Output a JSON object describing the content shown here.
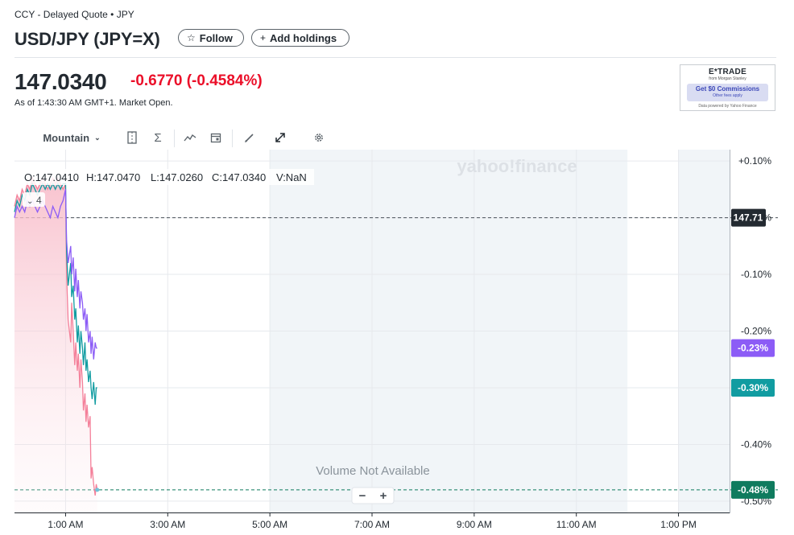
{
  "header": {
    "subtitle": "CCY - Delayed Quote • JPY",
    "title": "USD/JPY (JPY=X)",
    "follow_label": "Follow",
    "add_holdings_label": "Add holdings"
  },
  "quote": {
    "price": "147.0340",
    "change": "-0.6770 (-0.4584%)",
    "as_of": "As of 1:43:30 AM GMT+1. Market Open."
  },
  "ad": {
    "brand": "E*TRADE",
    "brand_sub": "from Morgan Stanley",
    "cta": "Get $0 Commissions",
    "cta_sub": "Other fees apply",
    "footer": "Data powered by Yahoo Finance"
  },
  "toolbar": {
    "chart_type": "Mountain",
    "icons": [
      "compare-icon",
      "indicators-icon",
      "trend-icon",
      "calendar-icon",
      "draw-icon",
      "expand-icon",
      "settings-icon"
    ]
  },
  "chart": {
    "watermark": "yahoo!finance",
    "ohlc": {
      "o": "O:147.0410",
      "h": "H:147.0470",
      "l": "L:147.0260",
      "c": "C:147.0340",
      "v": "V:NaN"
    },
    "collapse_badge": "4",
    "volume_note": "Volume Not Available",
    "zoom_out": "−",
    "zoom_in": "+",
    "price_tag": "147.71",
    "tags": [
      {
        "label": "-0.23%",
        "color": "#8c5cf6"
      },
      {
        "label": "-0.30%",
        "color": "#119ca1"
      },
      {
        "label": "-0.48%",
        "color": "#0f7b5e"
      }
    ]
  },
  "chart_data": {
    "type": "line",
    "x_tick_labels": [
      "1:00 AM",
      "3:00 AM",
      "5:00 AM",
      "7:00 AM",
      "9:00 AM",
      "11:00 AM",
      "1:00 PM"
    ],
    "x_ticks_hours": [
      1,
      3,
      5,
      7,
      9,
      11,
      13
    ],
    "x_range_hours": [
      0,
      14
    ],
    "y_tick_labels": [
      "+0.10%",
      "0.00%",
      "-0.10%",
      "-0.20%",
      "-0.30%",
      "-0.40%",
      "-0.50%"
    ],
    "y_ticks": [
      0.1,
      0.0,
      -0.1,
      -0.2,
      -0.3,
      -0.4,
      -0.5
    ],
    "y_range": [
      -0.52,
      0.12
    ],
    "shaded_sessions_hours": [
      [
        5,
        12
      ],
      [
        13,
        14
      ]
    ],
    "reference_lines": [
      0.0,
      -0.48
    ],
    "series": [
      {
        "color": "#f4809a",
        "area": true,
        "points": [
          [
            0,
            0.02
          ],
          [
            0.05,
            0.04
          ],
          [
            0.1,
            0.03
          ],
          [
            0.15,
            0.05
          ],
          [
            0.2,
            0.04
          ],
          [
            0.25,
            0.06
          ],
          [
            0.3,
            0.05
          ],
          [
            0.35,
            0.07
          ],
          [
            0.4,
            0.06
          ],
          [
            0.45,
            0.05
          ],
          [
            0.5,
            0.06
          ],
          [
            0.55,
            0.07
          ],
          [
            0.6,
            0.06
          ],
          [
            0.65,
            0.05
          ],
          [
            0.7,
            0.06
          ],
          [
            0.75,
            0.07
          ],
          [
            0.8,
            0.06
          ],
          [
            0.85,
            0.07
          ],
          [
            0.9,
            0.06
          ],
          [
            0.95,
            0.05
          ],
          [
            1.0,
            0.06
          ],
          [
            1.02,
            -0.1
          ],
          [
            1.05,
            -0.18
          ],
          [
            1.1,
            -0.22
          ],
          [
            1.12,
            -0.15
          ],
          [
            1.15,
            -0.2
          ],
          [
            1.18,
            -0.26
          ],
          [
            1.2,
            -0.22
          ],
          [
            1.23,
            -0.27
          ],
          [
            1.25,
            -0.24
          ],
          [
            1.28,
            -0.3
          ],
          [
            1.3,
            -0.25
          ],
          [
            1.33,
            -0.29
          ],
          [
            1.35,
            -0.34
          ],
          [
            1.38,
            -0.31
          ],
          [
            1.4,
            -0.36
          ],
          [
            1.42,
            -0.33
          ],
          [
            1.45,
            -0.37
          ],
          [
            1.48,
            -0.35
          ],
          [
            1.5,
            -0.46
          ],
          [
            1.52,
            -0.44
          ],
          [
            1.55,
            -0.47
          ],
          [
            1.58,
            -0.49
          ],
          [
            1.6,
            -0.47
          ],
          [
            1.62,
            -0.48
          ]
        ]
      },
      {
        "color": "#119ca1",
        "area": false,
        "points": [
          [
            0,
            0.01
          ],
          [
            0.05,
            0.03
          ],
          [
            0.1,
            0.02
          ],
          [
            0.15,
            0.04
          ],
          [
            0.2,
            0.03
          ],
          [
            0.25,
            0.05
          ],
          [
            0.3,
            0.04
          ],
          [
            0.35,
            0.06
          ],
          [
            0.4,
            0.05
          ],
          [
            0.45,
            0.04
          ],
          [
            0.5,
            0.05
          ],
          [
            0.55,
            0.06
          ],
          [
            0.6,
            0.05
          ],
          [
            0.65,
            0.06
          ],
          [
            0.7,
            0.05
          ],
          [
            0.75,
            0.06
          ],
          [
            0.8,
            0.05
          ],
          [
            0.85,
            0.06
          ],
          [
            0.9,
            0.05
          ],
          [
            0.95,
            0.06
          ],
          [
            1.0,
            0.06
          ],
          [
            1.02,
            -0.06
          ],
          [
            1.05,
            -0.12
          ],
          [
            1.1,
            -0.08
          ],
          [
            1.12,
            -0.14
          ],
          [
            1.15,
            -0.12
          ],
          [
            1.18,
            -0.18
          ],
          [
            1.2,
            -0.16
          ],
          [
            1.23,
            -0.22
          ],
          [
            1.25,
            -0.19
          ],
          [
            1.28,
            -0.24
          ],
          [
            1.3,
            -0.2
          ],
          [
            1.33,
            -0.23
          ],
          [
            1.35,
            -0.26
          ],
          [
            1.38,
            -0.22
          ],
          [
            1.4,
            -0.27
          ],
          [
            1.42,
            -0.25
          ],
          [
            1.45,
            -0.29
          ],
          [
            1.48,
            -0.27
          ],
          [
            1.5,
            -0.3
          ],
          [
            1.52,
            -0.32
          ],
          [
            1.55,
            -0.29
          ],
          [
            1.58,
            -0.33
          ],
          [
            1.6,
            -0.3
          ],
          [
            1.62,
            -0.3
          ]
        ]
      },
      {
        "color": "#8c5cf6",
        "area": false,
        "points": [
          [
            0,
            0.0
          ],
          [
            0.05,
            0.02
          ],
          [
            0.1,
            0.01
          ],
          [
            0.15,
            0.02
          ],
          [
            0.2,
            0.01
          ],
          [
            0.25,
            0.03
          ],
          [
            0.3,
            0.02
          ],
          [
            0.35,
            0.03
          ],
          [
            0.4,
            0.02
          ],
          [
            0.45,
            0.01
          ],
          [
            0.5,
            0.02
          ],
          [
            0.55,
            0.03
          ],
          [
            0.6,
            0.02
          ],
          [
            0.65,
            0.01
          ],
          [
            0.7,
            0.0
          ],
          [
            0.75,
            0.02
          ],
          [
            0.8,
            0.01
          ],
          [
            0.85,
            0.0
          ],
          [
            0.9,
            0.02
          ],
          [
            0.95,
            0.03
          ],
          [
            1.0,
            0.05
          ],
          [
            1.02,
            -0.04
          ],
          [
            1.05,
            -0.08
          ],
          [
            1.1,
            -0.05
          ],
          [
            1.12,
            -0.1
          ],
          [
            1.15,
            -0.07
          ],
          [
            1.18,
            -0.13
          ],
          [
            1.2,
            -0.09
          ],
          [
            1.23,
            -0.14
          ],
          [
            1.25,
            -0.11
          ],
          [
            1.28,
            -0.16
          ],
          [
            1.3,
            -0.13
          ],
          [
            1.33,
            -0.15
          ],
          [
            1.35,
            -0.18
          ],
          [
            1.38,
            -0.16
          ],
          [
            1.4,
            -0.2
          ],
          [
            1.42,
            -0.17
          ],
          [
            1.45,
            -0.22
          ],
          [
            1.48,
            -0.2
          ],
          [
            1.5,
            -0.24
          ],
          [
            1.52,
            -0.21
          ],
          [
            1.55,
            -0.25
          ],
          [
            1.58,
            -0.22
          ],
          [
            1.6,
            -0.23
          ],
          [
            1.62,
            -0.23
          ]
        ]
      }
    ]
  }
}
